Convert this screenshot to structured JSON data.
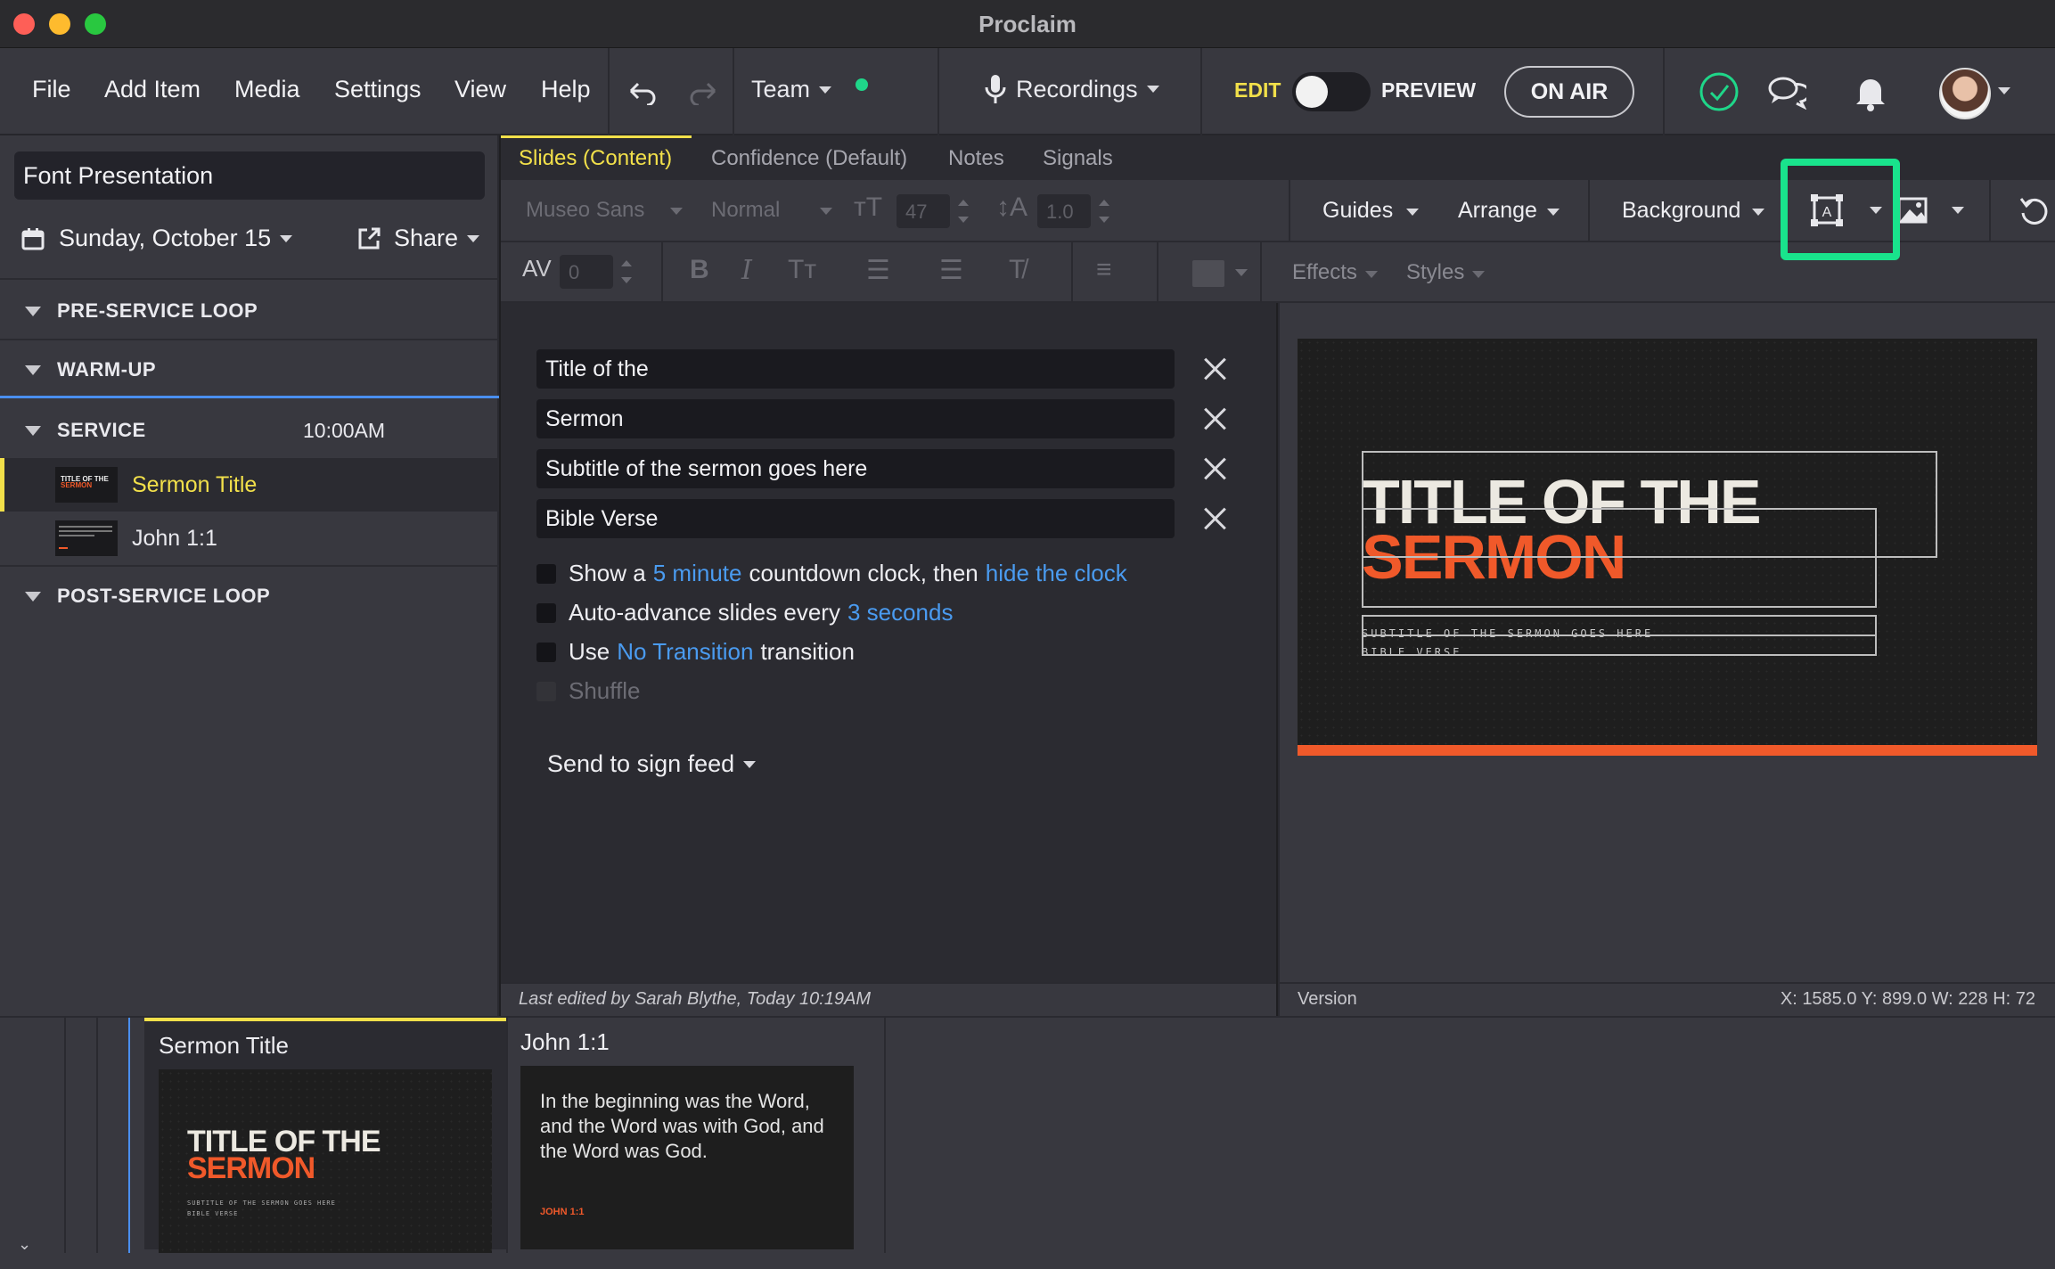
{
  "window": {
    "title": "Proclaim"
  },
  "menu": {
    "file": "File",
    "add_item": "Add Item",
    "media": "Media",
    "settings": "Settings",
    "view": "View",
    "help": "Help",
    "team": "Team",
    "recordings": "Recordings",
    "edit": "EDIT",
    "preview": "PREVIEW",
    "on_air": "ON AIR",
    "team_status_color": "#1fd689",
    "edit_accent": "#f2e04a"
  },
  "sidebar": {
    "presentation_name": "Font Presentation",
    "date": "Sunday, October 15",
    "share": "Share",
    "sections": [
      {
        "label": "PRE-SERVICE LOOP"
      },
      {
        "label": "WARM-UP"
      },
      {
        "label": "SERVICE",
        "time": "10:00AM"
      },
      {
        "label": "POST-SERVICE LOOP"
      }
    ],
    "items": [
      {
        "label": "Sermon Title",
        "active": true
      },
      {
        "label": "John 1:1",
        "active": false
      }
    ]
  },
  "tabs": [
    {
      "label": "Slides (Content)",
      "active": true
    },
    {
      "label": "Confidence (Default)"
    },
    {
      "label": "Notes"
    },
    {
      "label": "Signals"
    }
  ],
  "format": {
    "font": "Museo Sans",
    "weight": "Normal",
    "size": "47",
    "line_height": "1.0",
    "tracking": "0",
    "guides": "Guides",
    "arrange": "Arrange",
    "background": "Background",
    "effects": "Effects",
    "styles": "Styles",
    "highlight_color": "#19e38c"
  },
  "editor": {
    "fields": [
      "Title of the",
      "Sermon",
      "Subtitle of the sermon goes here",
      "Bible Verse"
    ],
    "options": {
      "countdown_pre": "Show a",
      "countdown_link": "5 minute",
      "countdown_mid": "countdown clock, then",
      "countdown_link2": "hide the clock",
      "advance_pre": "Auto-advance slides every",
      "advance_link": "3 seconds",
      "transition_pre": "Use",
      "transition_link": "No Transition",
      "transition_post": "transition",
      "shuffle": "Shuffle"
    },
    "send_to_sign_feed": "Send to sign feed"
  },
  "preview": {
    "title_line1": "TITLE OF THE",
    "title_line2": "SERMON",
    "subtitle": "SUBTITLE OF THE SERMON GOES HERE",
    "verse": "BIBLE VERSE",
    "accent_color": "#f0592a"
  },
  "status": {
    "last_edited": "Last edited by Sarah Blythe, Today 10:19AM",
    "version": "Version",
    "coords": "X: 1585.0  Y: 899.0    W: 228  H: 72"
  },
  "filmstrip": [
    {
      "label": "Sermon Title",
      "t1": "TITLE OF THE",
      "t2": "SERMON",
      "s1": "SUBTITLE OF THE SERMON GOES HERE",
      "s2": "BIBLE VERSE"
    },
    {
      "label": "John 1:1",
      "text": "In the beginning was the Word, and the Word was with God, and the Word was God.",
      "ref": "JOHN 1:1"
    }
  ]
}
